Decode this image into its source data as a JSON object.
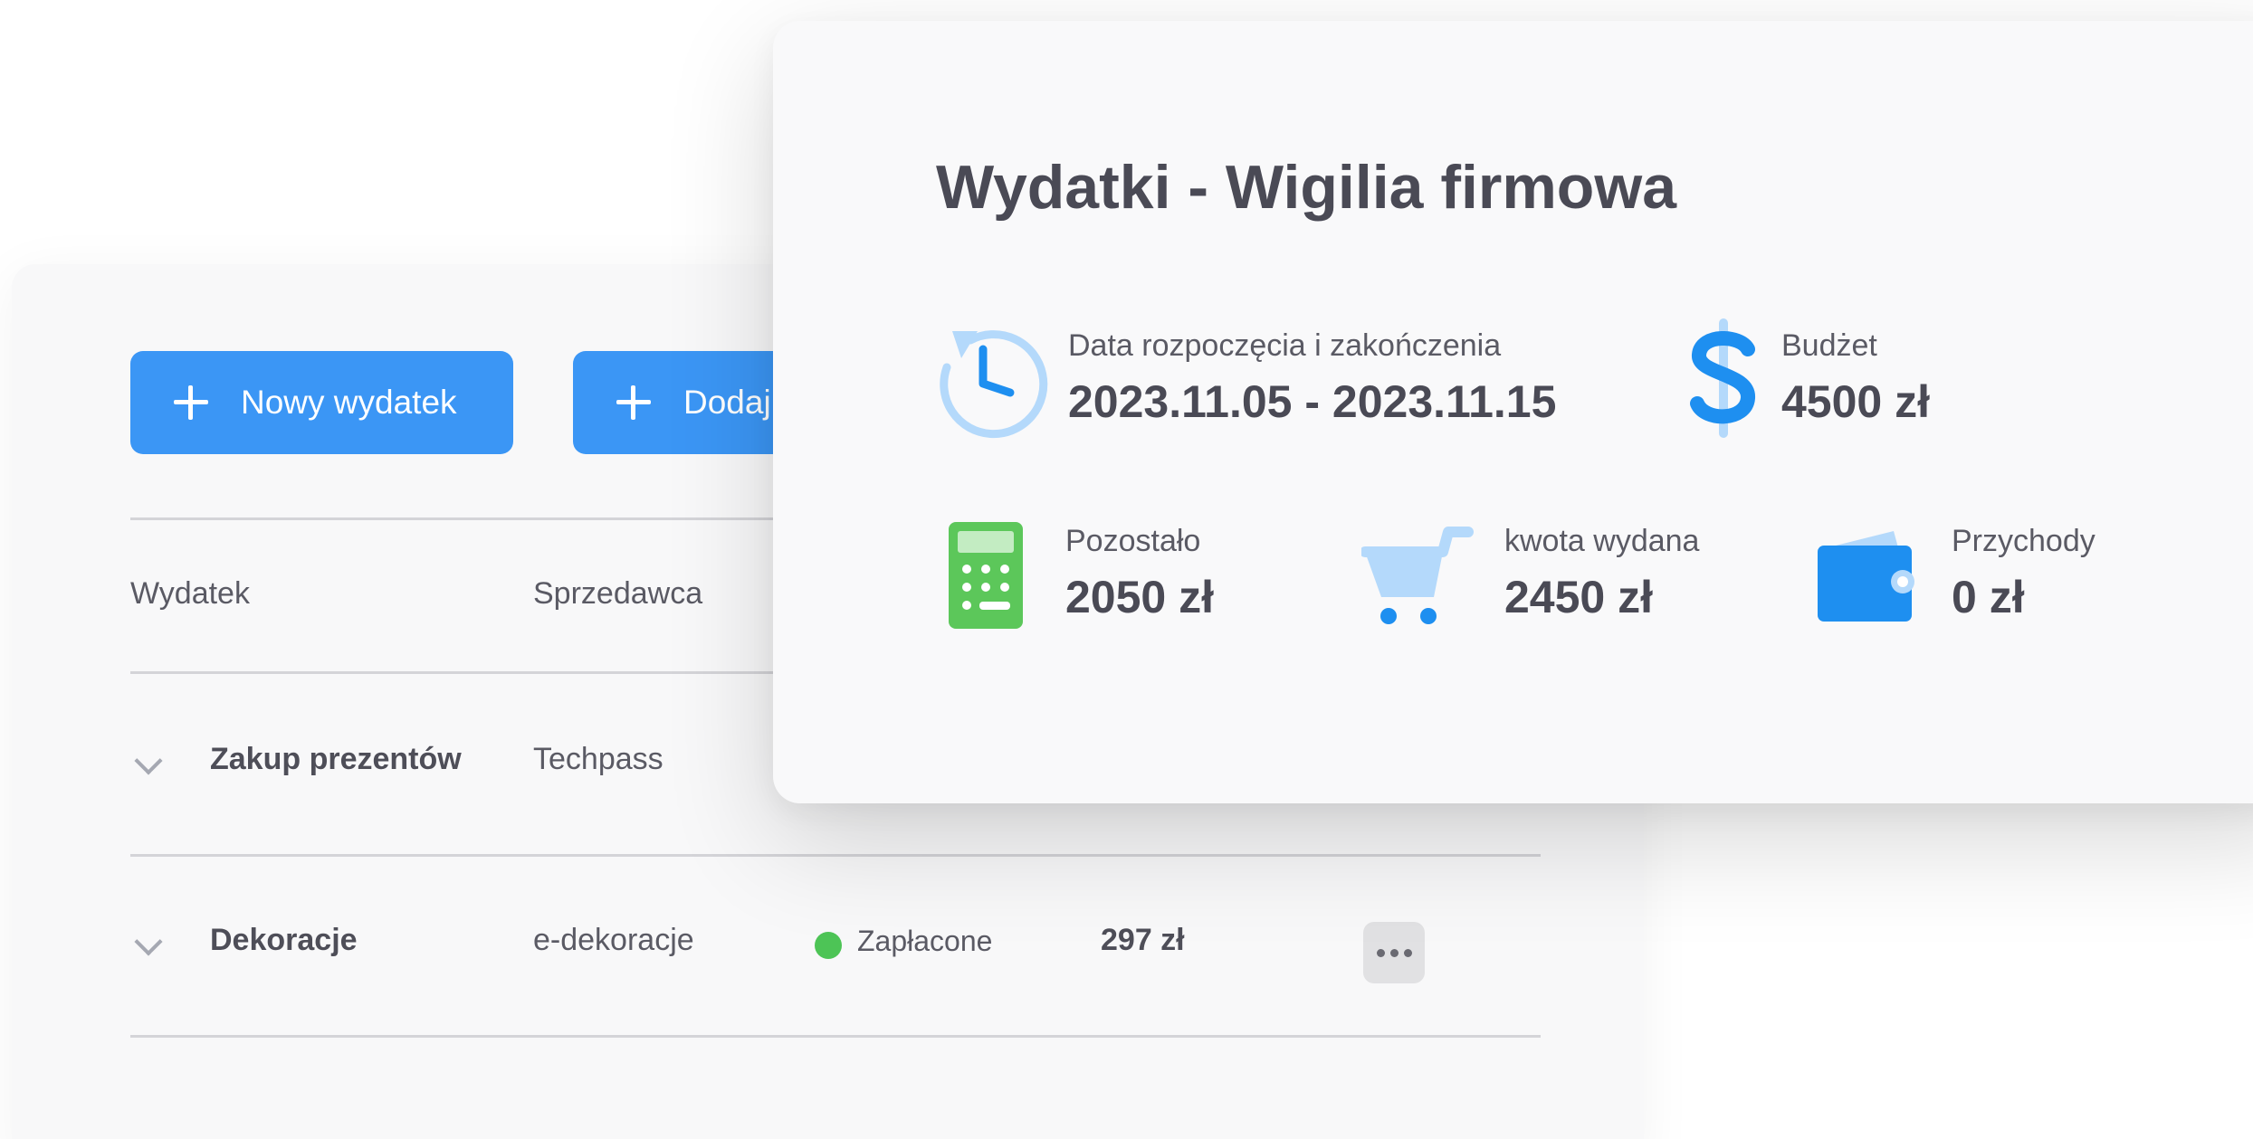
{
  "toolbar": {
    "new_expense_label": "Nowy wydatek",
    "add_label": "Dodaj"
  },
  "table": {
    "columns": [
      "Wydatek",
      "Sprzedawca"
    ],
    "rows": [
      {
        "name": "Zakup prezentów",
        "vendor": "Techpass",
        "status": "",
        "amount": ""
      },
      {
        "name": "Dekoracje",
        "vendor": "e-dekoracje",
        "status": "Zapłacone",
        "amount": "297 zł"
      }
    ]
  },
  "summary": {
    "title": "Wydatki - Wigilia firmowa",
    "dates": {
      "label": "Data rozpoczęcia i zakończenia",
      "value": "2023.11.05 - 2023.11.15",
      "icon": "clock-history-icon"
    },
    "budget": {
      "label": "Budżet",
      "value": "4500 zł",
      "icon": "dollar-icon"
    },
    "remaining": {
      "label": "Pozostało",
      "value": "2050 zł",
      "icon": "calculator-icon"
    },
    "spent": {
      "label": "kwota wydana",
      "value": "2450 zł",
      "icon": "cart-icon"
    },
    "income": {
      "label": "Przychody",
      "value": "0 zł",
      "icon": "wallet-icon"
    }
  },
  "colors": {
    "primary": "#3b96f5",
    "success": "#4dc456",
    "accent_blue": "#1e8ff0",
    "light_blue": "#b4d9fb",
    "calculator_green": "#5cc75a",
    "text": "#4a4a55"
  }
}
